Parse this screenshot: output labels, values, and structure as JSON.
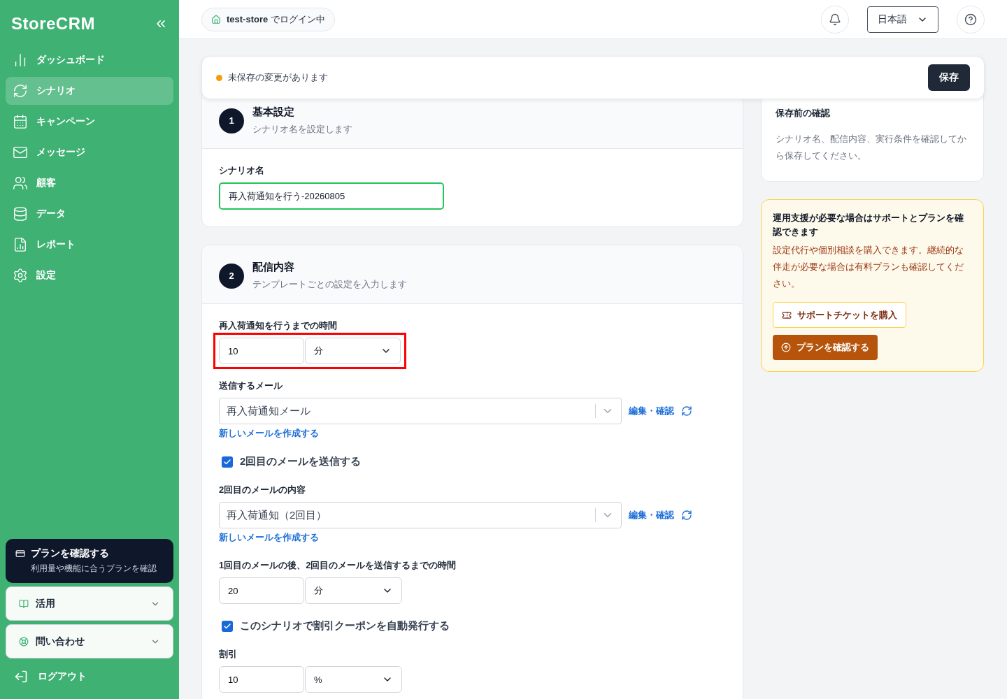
{
  "sidebar": {
    "logo": "StoreCRM",
    "nav": [
      {
        "label": "ダッシュボード",
        "selected": false
      },
      {
        "label": "シナリオ",
        "selected": true
      },
      {
        "label": "キャンペーン",
        "selected": false
      },
      {
        "label": "メッセージ",
        "selected": false
      },
      {
        "label": "顧客",
        "selected": false
      },
      {
        "label": "データ",
        "selected": false
      },
      {
        "label": "レポート",
        "selected": false
      },
      {
        "label": "設定",
        "selected": false
      }
    ],
    "plan_card": {
      "title": "プランを確認する",
      "subtitle": "利用量や機能に合うプランを確認"
    },
    "groups": [
      {
        "label": "活用",
        "expanded": false
      },
      {
        "label": "問い合わせ",
        "expanded": false
      }
    ],
    "logout": "ログアウト"
  },
  "header": {
    "login": "**test-store** でログイン中",
    "language": "日本語"
  },
  "unsaved_bar": {
    "message": "未保存の変更があります",
    "save_button": "保存"
  },
  "sections": [
    {
      "number": "1",
      "title": "基本設定",
      "subtitle": "シナリオ名を設定します",
      "fields": [
        {
          "kind": "text",
          "label": "シナリオ名",
          "value": "再入荷通知を行う-20260805",
          "focused": true
        }
      ]
    },
    {
      "number": "2",
      "title": "配信内容",
      "subtitle": "テンプレートごとの設定を入力します",
      "fields": [
        {
          "kind": "duration",
          "label": "再入荷通知を行うまでの時間",
          "value": "10",
          "unit": "分",
          "highlighted": true
        },
        {
          "kind": "select",
          "label": "送信するメール",
          "value": "再入荷通知メール",
          "edit_link": "編集・確認",
          "new_link": "新しいメールを作成する"
        },
        {
          "kind": "checkbox",
          "label": "2回目のメールを送信する",
          "checked": true
        },
        {
          "kind": "select",
          "label": "2回目のメールの内容",
          "value": "再入荷通知（2回目）",
          "edit_link": "編集・確認",
          "new_link": "新しいメールを作成する"
        },
        {
          "kind": "duration",
          "label": "1回目のメールの後、2回目のメールを送信するまでの時間",
          "value": "20",
          "unit": "分",
          "highlighted": false
        },
        {
          "kind": "checkbox",
          "label": "このシナリオで割引クーポンを自動発行する",
          "checked": true
        },
        {
          "kind": "duration",
          "label": "割引",
          "value": "10",
          "unit": "%",
          "highlighted": false
        }
      ]
    }
  ],
  "side_panel": {
    "confirm": {
      "title": "保存前の確認",
      "text": "シナリオ名、配信内容、実行条件を確認してから保存してください。"
    },
    "support": {
      "title": "運用支援が必要な場合はサポートとプランを確認できます",
      "text": "設定代行や個別相談を購入できます。継続的な伴走が必要な場合は有料プランも確認してください。",
      "ticket_button": "サポートチケットを購入",
      "plan_button": "プランを確認する"
    }
  }
}
